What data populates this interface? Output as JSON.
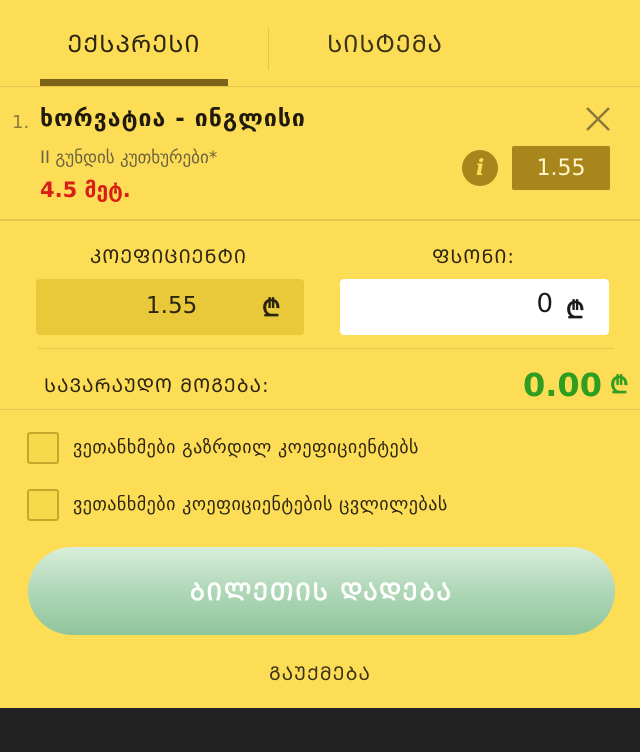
{
  "tabs": [
    {
      "label": "ᲔᲥᲡᲞᲠᲔᲡᲘ",
      "active": true
    },
    {
      "label": "ᲡᲘᲡᲢᲔᲛᲐ",
      "active": false
    }
  ],
  "bet": {
    "index": "1.",
    "title": "ხორვატია - ინგლისი",
    "market": "II გუნდის კუთხურები*",
    "pick": "4.5 მეტ.",
    "odd": "1.55"
  },
  "icons": {
    "close": "close-icon",
    "info": "info-icon",
    "currency": "lari-icon",
    "info_glyph": "i",
    "lari_glyph": "₾"
  },
  "coef": {
    "label": "ᲙᲝᲔᲤᲘᲪᲘᲔᲜᲢᲘ",
    "value": "1.55"
  },
  "stake": {
    "label": "ᲤᲡᲝᲜᲘ:",
    "value": "0"
  },
  "win": {
    "label": "ᲡᲐᲕᲐᲠᲐᲣᲓᲝ ᲛᲝᲒᲔᲑᲐ:",
    "value": "0.00"
  },
  "options": [
    {
      "label": "ვეთანხმები გაზრდილ კოეფიციენტებს",
      "checked": false
    },
    {
      "label": "ვეთანხმები კოეფიციენტების ცვლილებას",
      "checked": false
    }
  ],
  "actions": {
    "place_bet": "ᲑᲘᲚᲔᲗᲘᲡ ᲓᲐᲓᲔᲑᲐ",
    "cancel": "ᲒᲐᲣᲥᲛᲔᲑᲐ"
  },
  "colors": {
    "background": "#fddd56",
    "accent": "#a8861c",
    "pick": "#d91e18",
    "win": "#2e9d20",
    "button": "#a9d6b3"
  }
}
